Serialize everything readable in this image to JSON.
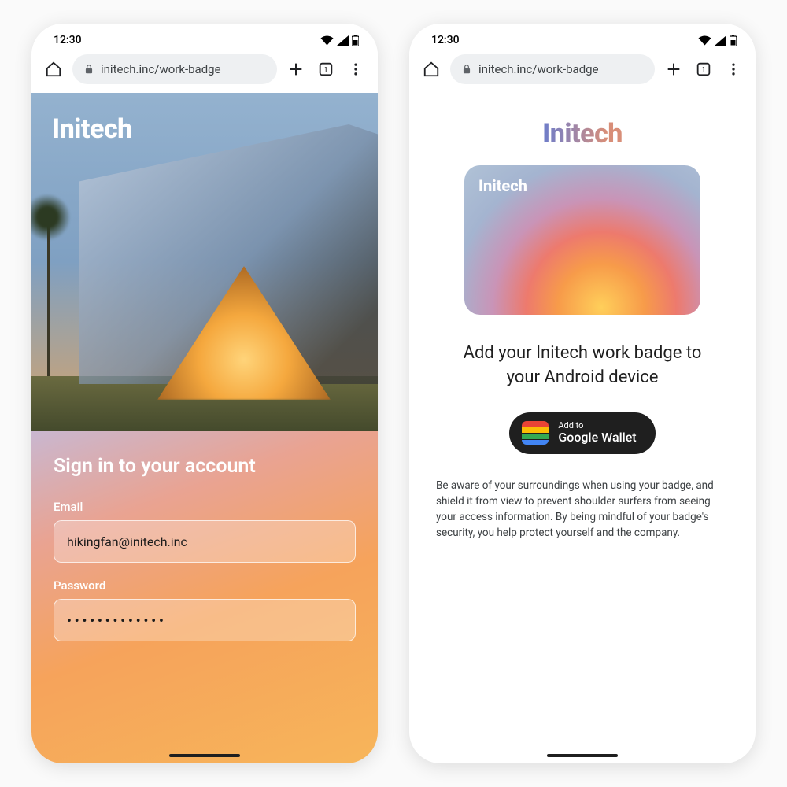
{
  "status": {
    "time": "12:30"
  },
  "browser": {
    "url": "initech.inc/work-badge"
  },
  "brand": "Initech",
  "phone1": {
    "signin_heading": "Sign in to your account",
    "email_label": "Email",
    "email_value": "hikingfan@initech.inc",
    "password_label": "Password",
    "password_mask": "•••••••••••••"
  },
  "phone2": {
    "headline": "Add your Initech work badge to your Android device",
    "wallet_small": "Add to",
    "wallet_big": "Google Wallet",
    "disclaimer": "Be aware of your surroundings when using your badge, and shield it from view to prevent shoulder surfers from seeing your access information.  By being mindful of your badge's security, you help protect yourself and the company."
  }
}
